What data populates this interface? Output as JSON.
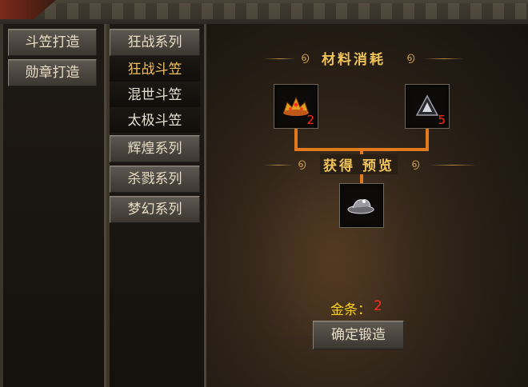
{
  "tabs": [
    {
      "label": "斗笠打造"
    },
    {
      "label": "勋章打造"
    }
  ],
  "categories": [
    {
      "label": "狂战系列"
    },
    {
      "label": "辉煌系列"
    },
    {
      "label": "杀戮系列"
    },
    {
      "label": "梦幻系列"
    }
  ],
  "sub_items": [
    {
      "label": "狂战斗笠"
    },
    {
      "label": "混世斗笠"
    },
    {
      "label": "太极斗笠"
    }
  ],
  "materials": {
    "title": "材料消耗",
    "items": [
      {
        "icon": "golden-crown-icon",
        "count": "2"
      },
      {
        "icon": "dark-gem-icon",
        "count": "5"
      }
    ]
  },
  "preview": {
    "title": "获得 预览",
    "icon": "silver-hat-icon"
  },
  "cost": {
    "label": "金条：",
    "value": "2"
  },
  "confirm_label": "确定锻造"
}
